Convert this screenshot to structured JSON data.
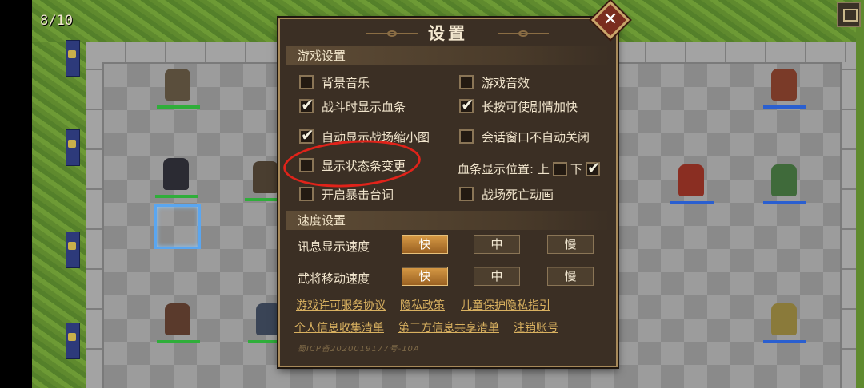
{
  "hud": {
    "turn_counter": "8/10",
    "menu_icon": "menu-icon"
  },
  "settings": {
    "title": "设置",
    "close_icon": "close-icon",
    "game_section": {
      "header": "游戏设置",
      "options": [
        {
          "label": "背景音乐",
          "checked": false
        },
        {
          "label": "游戏音效",
          "checked": false
        },
        {
          "label": "战斗时显示血条",
          "checked": true
        },
        {
          "label": "长按可使剧情加快",
          "checked": true
        },
        {
          "label": "自动显示战场缩小图",
          "checked": true
        },
        {
          "label": "会话窗口不自动关闭",
          "checked": false
        },
        {
          "label": "显示状态条变更",
          "checked": false
        },
        {
          "label": "开启暴击台词",
          "checked": false
        },
        {
          "label": "战场死亡动画",
          "checked": false
        }
      ],
      "bar_position": {
        "label": "血条显示位置: 上",
        "top_checked": false,
        "bottom_label": "下",
        "bottom_checked": true
      }
    },
    "speed_section": {
      "header": "速度设置",
      "rows": [
        {
          "label": "讯息显示速度",
          "options": [
            "快",
            "中",
            "慢"
          ],
          "selected": "快"
        },
        {
          "label": "武将移动速度",
          "options": [
            "快",
            "中",
            "慢"
          ],
          "selected": "快"
        }
      ]
    },
    "links": [
      "游戏许可服务协议",
      "隐私政策",
      "儿童保护隐私指引",
      "个人信息收集清单",
      "第三方信息共享清单",
      "注销账号"
    ],
    "icp_text": "蜀ICP备2020019177号-10A"
  },
  "colors": {
    "panel_bg": "#3b2f24",
    "panel_border": "#a88a5a",
    "active_button": "#b87f33",
    "link": "#d9b160",
    "annotation": "#e0231a"
  }
}
